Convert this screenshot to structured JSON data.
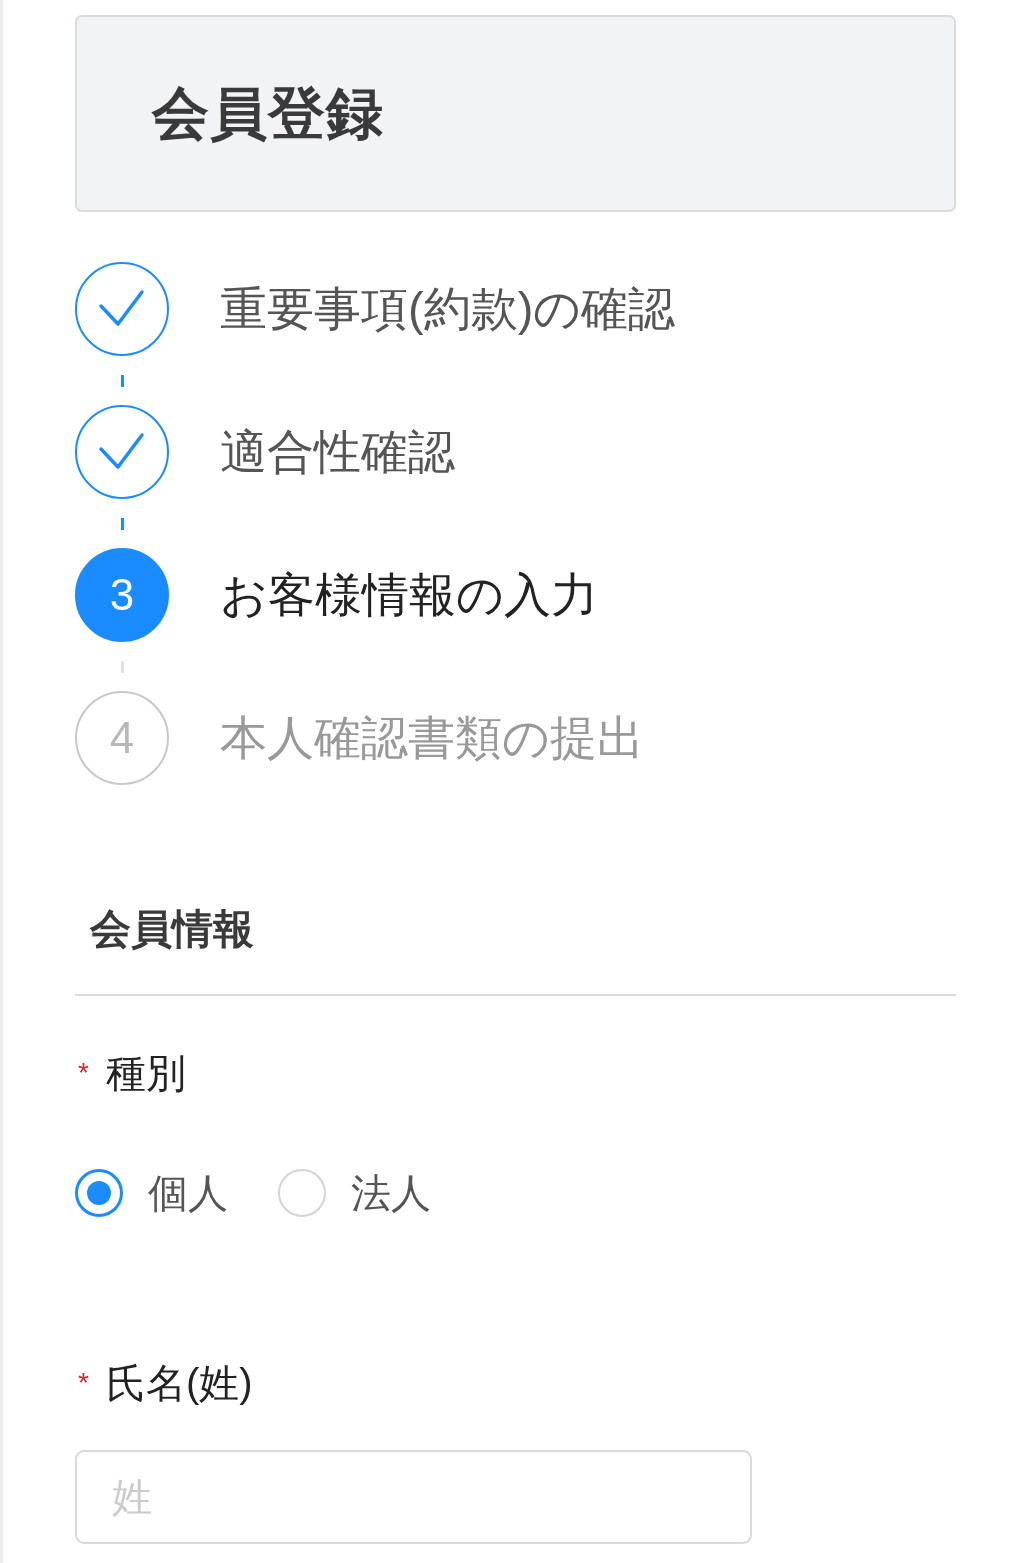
{
  "header": {
    "title": "会員登録"
  },
  "steps": [
    {
      "label": "重要事項(約款)の確認",
      "completed": true,
      "selected": false
    },
    {
      "label": "適合性確認",
      "completed": true,
      "selected": false
    },
    {
      "number": "3",
      "label": "お客様情報の入力",
      "completed": false,
      "selected": true
    },
    {
      "number": "4",
      "label": "本人確認書類の提出",
      "completed": false,
      "selected": false
    }
  ],
  "section": {
    "title": "会員情報"
  },
  "fields": [
    {
      "kind": "radio",
      "required_mark": "*",
      "label": "種別",
      "options": [
        {
          "label": "個人",
          "selected": true
        },
        {
          "label": "法人",
          "selected": false
        }
      ]
    },
    {
      "kind": "text",
      "required_mark": "*",
      "label": "氏名(姓)",
      "placeholder": "姓"
    }
  ]
}
